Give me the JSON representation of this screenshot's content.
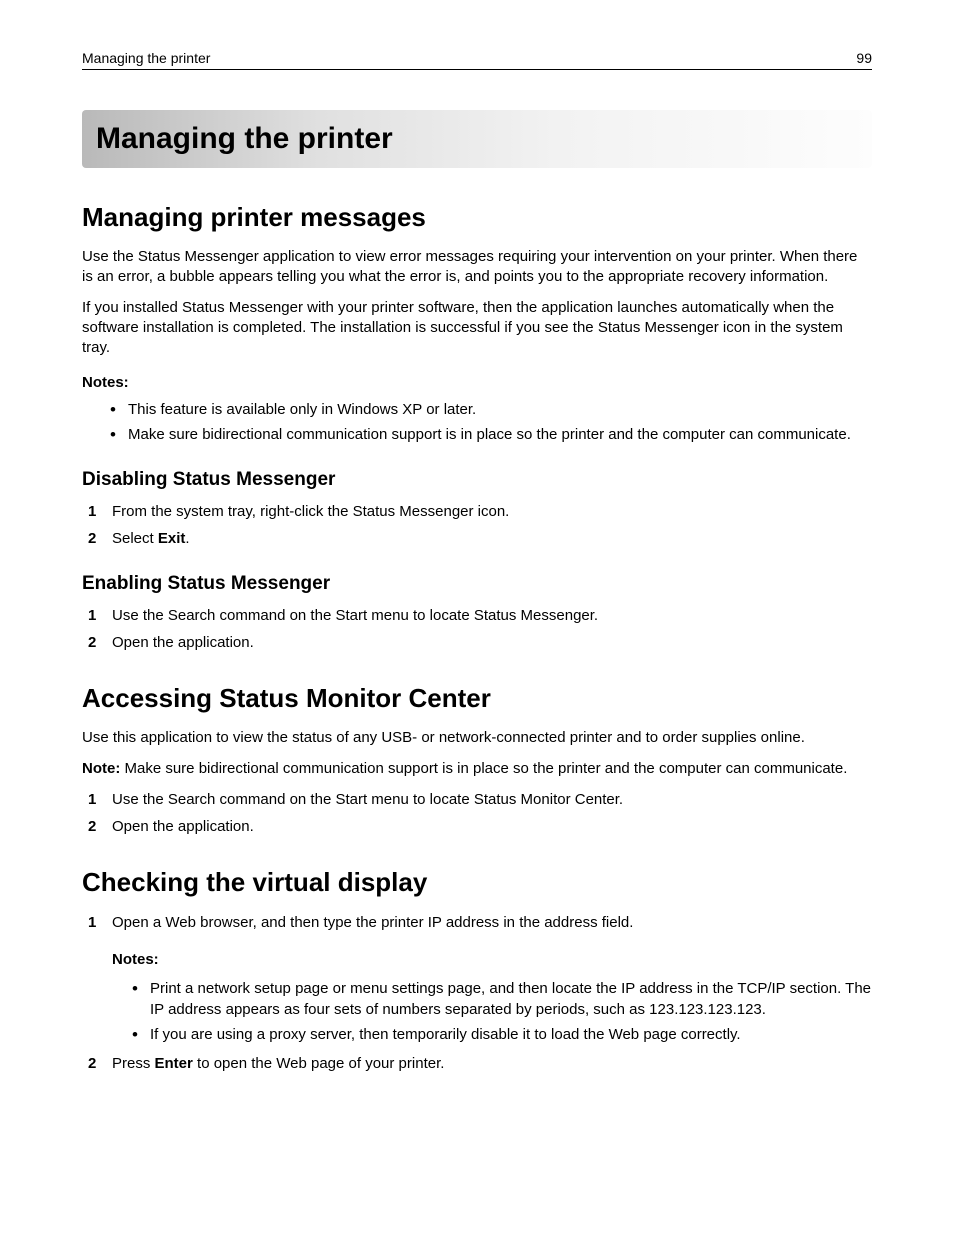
{
  "header": {
    "running_title": "Managing the printer",
    "page_number": "99"
  },
  "chapter_title": "Managing the printer",
  "section1": {
    "title": "Managing printer messages",
    "p1": "Use the Status Messenger application to view error messages requiring your intervention on your printer. When there is an error, a bubble appears telling you what the error is, and points you to the appropriate recovery information.",
    "p2": "If you installed Status Messenger with your printer software, then the application launches automatically when the software installation is completed. The installation is successful if you see the Status Messenger icon in the system tray.",
    "notes_label": "Notes:",
    "notes": [
      "This feature is available only in Windows XP or later.",
      "Make sure bidirectional communication support is in place so the printer and the computer can communicate."
    ],
    "sub1": {
      "title": "Disabling Status Messenger",
      "step1": "From the system tray, right-click the Status Messenger icon.",
      "step2_pre": "Select ",
      "step2_bold": "Exit",
      "step2_post": "."
    },
    "sub2": {
      "title": "Enabling Status Messenger",
      "step1": "Use the Search command on the Start menu to locate Status Messenger.",
      "step2": "Open the application."
    }
  },
  "section2": {
    "title": "Accessing Status Monitor Center",
    "p1": "Use this application to view the status of any USB- or network-connected printer and to order supplies online.",
    "note_label": "Note:",
    "note_text": " Make sure bidirectional communication support is in place so the printer and the computer can communicate.",
    "step1": "Use the Search command on the Start menu to locate Status Monitor Center.",
    "step2": "Open the application."
  },
  "section3": {
    "title": "Checking the virtual display",
    "step1": "Open a Web browser, and then type the printer IP address in the address field.",
    "notes_label": "Notes:",
    "notes": [
      "Print a network setup page or menu settings page, and then locate the IP address in the TCP/IP section. The IP address appears as four sets of numbers separated by periods, such as 123.123.123.123.",
      "If you are using a proxy server, then temporarily disable it to load the Web page correctly."
    ],
    "step2_pre": "Press ",
    "step2_bold": "Enter",
    "step2_post": " to open the Web page of your printer."
  }
}
